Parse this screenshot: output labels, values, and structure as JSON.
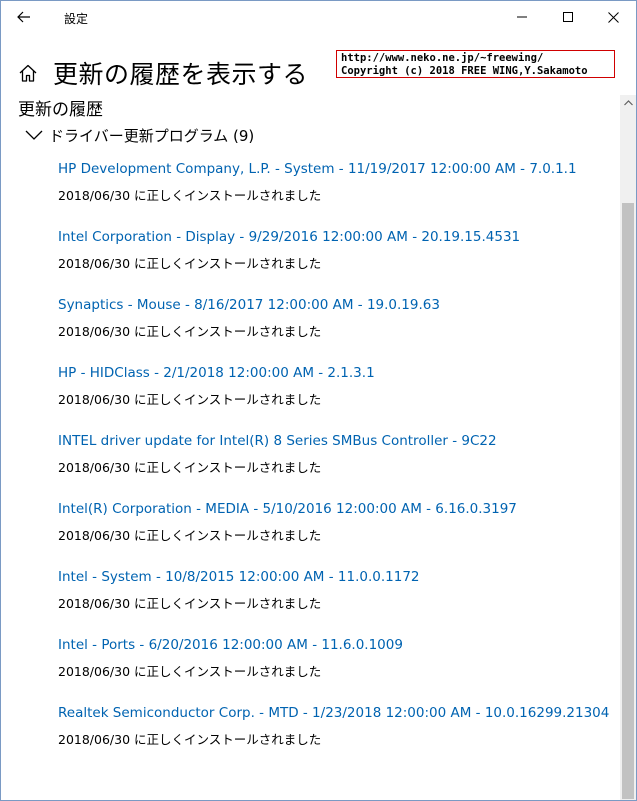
{
  "window": {
    "title": "設定",
    "buttons": {
      "minimize": "minimize-icon",
      "maximize": "maximize-icon",
      "close": "close-icon"
    }
  },
  "header": {
    "title": "更新の履歴を表示する"
  },
  "stamp": {
    "line1": "http://www.neko.ne.jp/~freewing/",
    "line2": "Copyright (c) 2018 FREE WING,Y.Sakamoto"
  },
  "section": {
    "title": "更新の履歴"
  },
  "group": {
    "label": "ドライバー更新プログラム (9)"
  },
  "updates": [
    {
      "name": "HP Development Company, L.P. - System - 11/19/2017 12:00:00 AM - 7.0.1.1",
      "status": "2018/06/30 に正しくインストールされました"
    },
    {
      "name": "Intel Corporation - Display - 9/29/2016 12:00:00 AM - 20.19.15.4531",
      "status": "2018/06/30 に正しくインストールされました"
    },
    {
      "name": "Synaptics - Mouse - 8/16/2017 12:00:00 AM - 19.0.19.63",
      "status": "2018/06/30 に正しくインストールされました"
    },
    {
      "name": "HP - HIDClass - 2/1/2018 12:00:00 AM - 2.1.3.1",
      "status": "2018/06/30 に正しくインストールされました"
    },
    {
      "name": "INTEL driver update for Intel(R) 8 Series SMBus Controller - 9C22",
      "status": "2018/06/30 に正しくインストールされました"
    },
    {
      "name": "Intel(R) Corporation - MEDIA - 5/10/2016 12:00:00 AM - 6.16.0.3197",
      "status": "2018/06/30 に正しくインストールされました"
    },
    {
      "name": "Intel - System - 10/8/2015 12:00:00 AM - 11.0.0.1172",
      "status": "2018/06/30 に正しくインストールされました"
    },
    {
      "name": "Intel - Ports - 6/20/2016 12:00:00 AM - 11.6.0.1009",
      "status": "2018/06/30 に正しくインストールされました"
    },
    {
      "name": "Realtek Semiconductor Corp. - MTD - 1/23/2018 12:00:00 AM - 10.0.16299.21304",
      "status": "2018/06/30 に正しくインストールされました"
    }
  ],
  "colors": {
    "link": "#0063b1",
    "window_border": "#7a9ac4",
    "stamp_border": "#d00000"
  }
}
